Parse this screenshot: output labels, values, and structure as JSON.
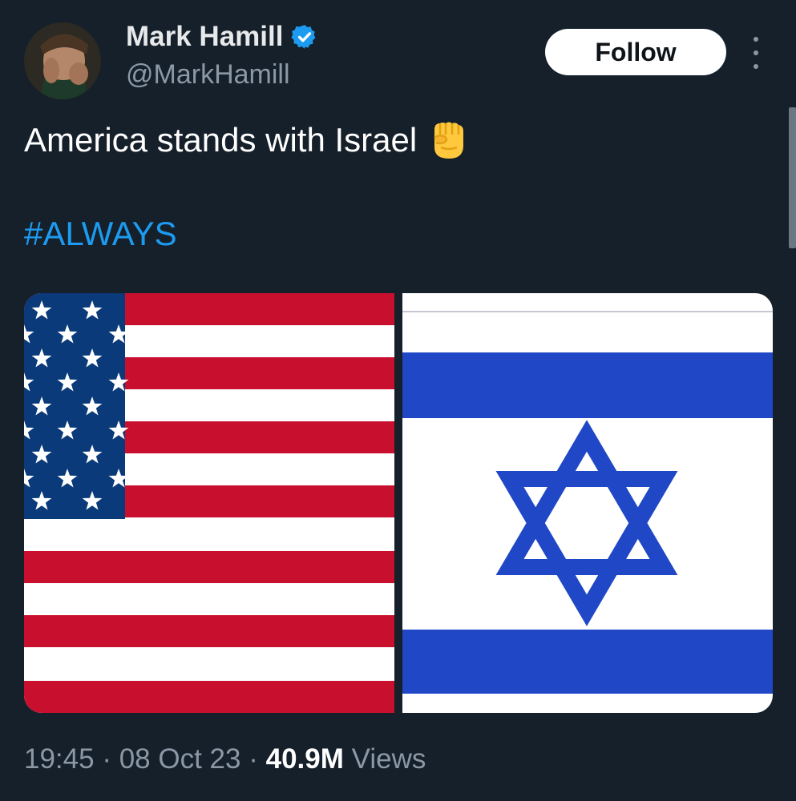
{
  "author": {
    "display_name": "Mark Hamill",
    "handle": "@MarkHamill",
    "verified": true
  },
  "actions": {
    "follow_label": "Follow"
  },
  "tweet": {
    "text": "America stands with Israel",
    "emoji": "raised-fist-emoji",
    "hashtag": "#ALWAYS"
  },
  "media": {
    "left_flag": "us-flag",
    "right_flag": "israel-flag"
  },
  "meta": {
    "time": "19:45",
    "sep1": "·",
    "date": "08 Oct 23",
    "sep2": "·",
    "views_count": "40.9M",
    "views_label": "Views"
  },
  "colors": {
    "background": "#15202b",
    "link": "#1d9bf0",
    "secondary_text": "#8b98a5",
    "us_red": "#c8102e",
    "us_blue": "#0a3a7a",
    "il_blue": "#1f47c6"
  }
}
